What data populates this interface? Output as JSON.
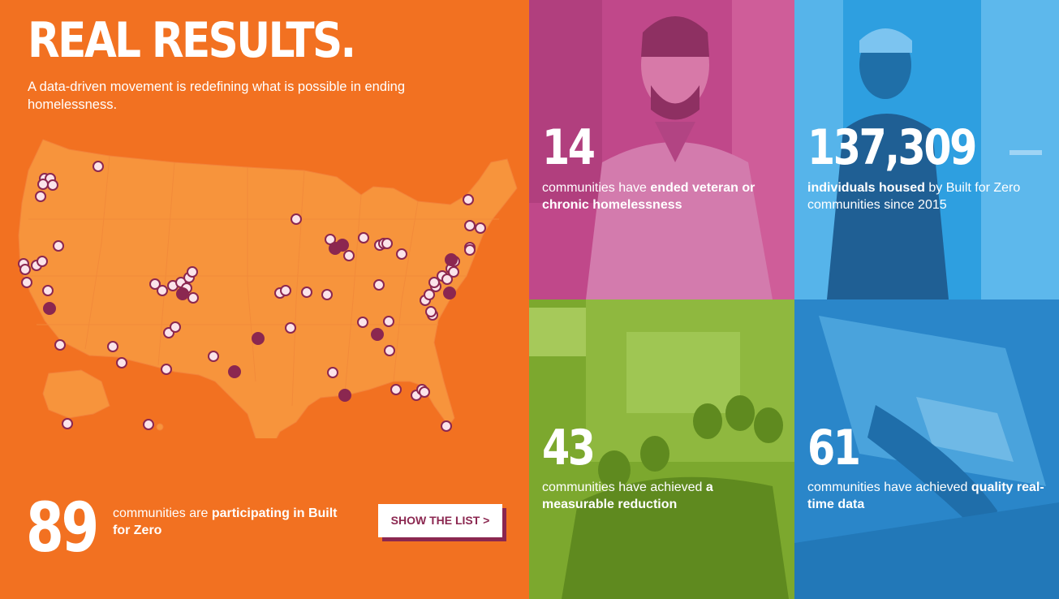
{
  "header": {
    "title": "REAL RESULTS.",
    "subtitle": "A data-driven movement is redefining what is possible in ending homelessness."
  },
  "participation": {
    "count": "89",
    "text_pre": "communities are ",
    "text_bold": "participating in Built for Zero",
    "button_label": "SHOW THE LIST >"
  },
  "map": {
    "icon": "us-map",
    "marker_colors": {
      "participating": "#fbe4ea",
      "achieved": "#8b2750",
      "marker_stroke": "#8b2750"
    }
  },
  "stats": [
    {
      "id": "ended",
      "number": "14",
      "text_pre": "communities have ",
      "text_bold": "ended veteran or chronic homelessness",
      "text_post": "",
      "color": "#c0488a"
    },
    {
      "id": "housed",
      "number": "137,309",
      "text_pre": "",
      "text_bold": "individuals housed",
      "text_post": " by Built for Zero communities since 2015",
      "color": "#2e9fe0"
    },
    {
      "id": "reduction",
      "number": "43",
      "text_pre": "communities have achieved ",
      "text_bold": "a measurable reduction",
      "text_post": "",
      "color": "#7ca82e"
    },
    {
      "id": "quality",
      "number": "61",
      "text_pre": "communities have achieved ",
      "text_bold": "quality real-time data",
      "text_post": "",
      "color": "#2a86c9"
    }
  ],
  "colors": {
    "orange": "#f27121",
    "map_fill": "#f7943c",
    "accent": "#8b2750"
  }
}
